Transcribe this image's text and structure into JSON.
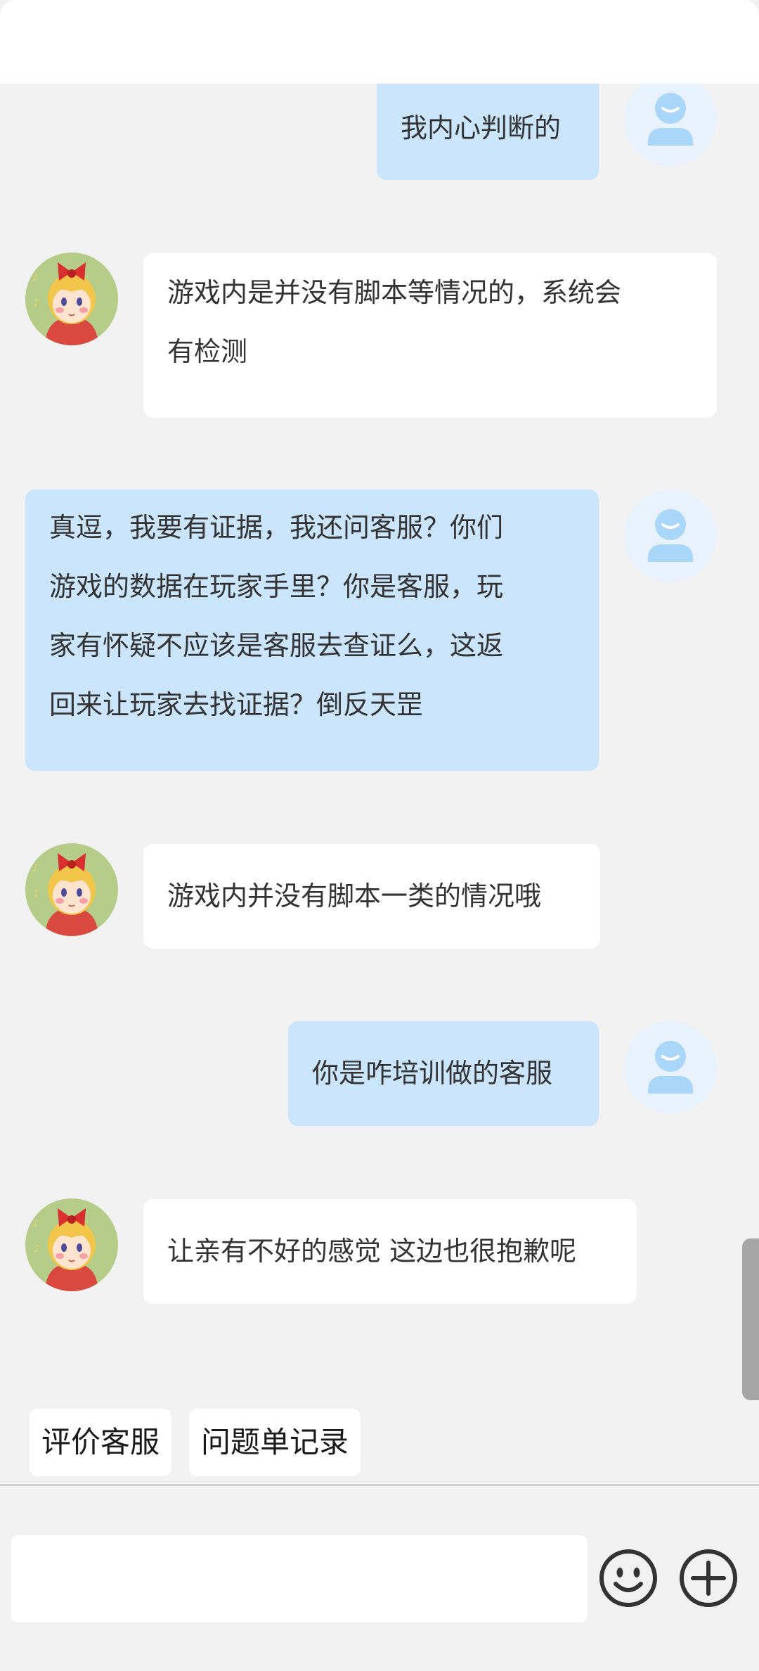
{
  "messages": [
    {
      "sender": "user",
      "text": "我内心判断的"
    },
    {
      "sender": "agent",
      "text": "游戏内是并没有脚本等情况的，系统会\n有检测"
    },
    {
      "sender": "user",
      "text": "真逗，我要有证据，我还问客服？你们\n游戏的数据在玩家手里？你是客服，玩\n家有怀疑不应该是客服去查证么，这返\n回来让玩家去找证据？倒反天罡"
    },
    {
      "sender": "agent",
      "text": "游戏内并没有脚本一类的情况哦"
    },
    {
      "sender": "user",
      "text": "你是咋培训做的客服"
    },
    {
      "sender": "agent",
      "text": "让亲有不好的感觉 这边也很抱歉呢"
    }
  ],
  "quick_actions": {
    "rate_label": "评价客服",
    "tickets_label": "问题单记录"
  },
  "composer": {
    "input_value": "",
    "emoji_icon": "smiley-icon",
    "plus_icon": "plus-circle-icon"
  },
  "colors": {
    "background": "#f2f2f2",
    "user_bubble": "#cbe5fc",
    "agent_bubble": "#ffffff",
    "user_avatar_bg": "#e7f2fd",
    "user_avatar_figure": "#a9d6f9"
  }
}
